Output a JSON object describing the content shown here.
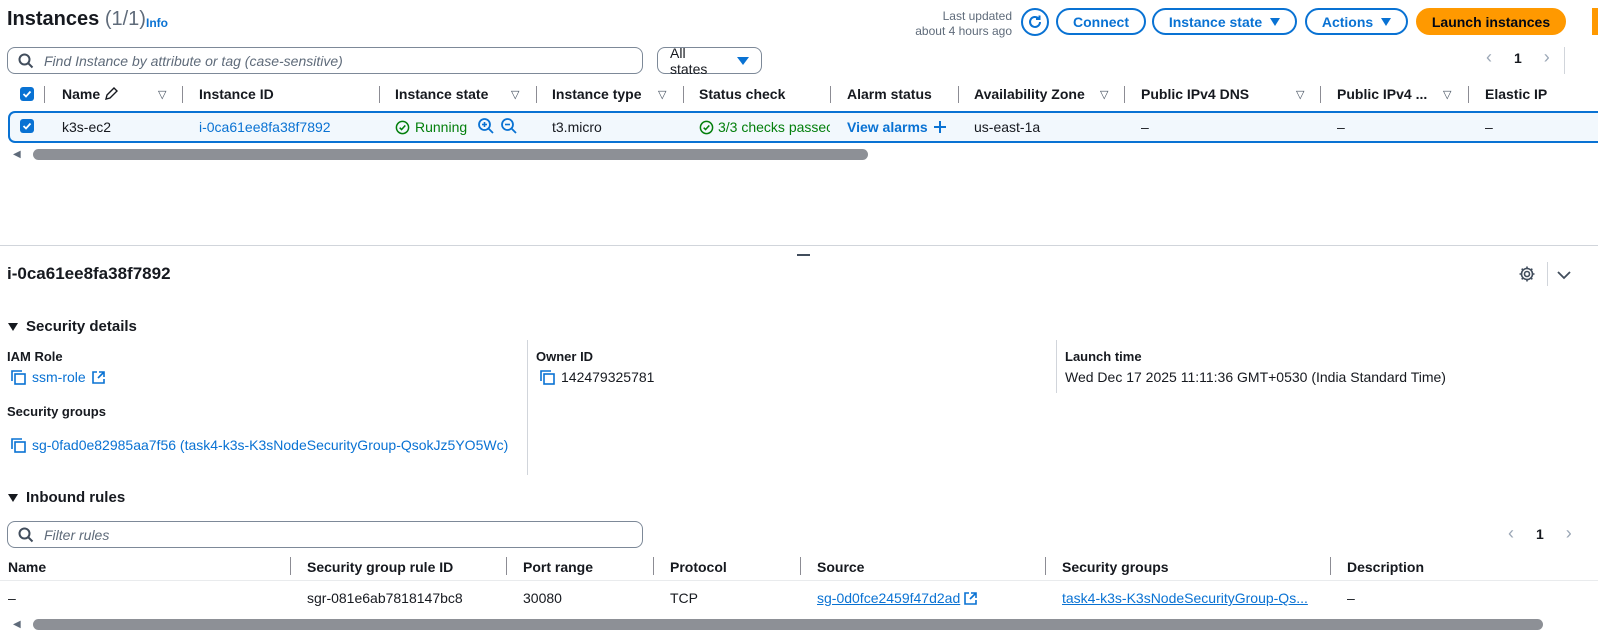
{
  "instances": {
    "title": "Instances",
    "count": "(1/1)",
    "info": "Info",
    "last_updated_label": "Last updated",
    "last_updated_value": "about 4 hours ago",
    "buttons": {
      "connect": "Connect",
      "instance_state": "Instance state",
      "actions": "Actions",
      "launch": "Launch instances"
    },
    "search_placeholder": "Find Instance by attribute or tag (case-sensitive)",
    "state_filter": "All states",
    "page": "1",
    "columns": [
      "Name",
      "Instance ID",
      "Instance state",
      "Instance type",
      "Status check",
      "Alarm status",
      "Availability Zone",
      "Public IPv4 DNS",
      "Public IPv4 ...",
      "Elastic IP"
    ],
    "row": {
      "name": "k3s-ec2",
      "instance_id": "i-0ca61ee8fa38f7892",
      "state": "Running",
      "type": "t3.micro",
      "status_check": "3/3 checks passec",
      "alarm": "View alarms",
      "az": "us-east-1a",
      "dns": "–",
      "ipv4": "–",
      "eip": "–"
    }
  },
  "details": {
    "instance_id": "i-0ca61ee8fa38f7892",
    "security_details_title": "Security details",
    "iam_role_label": "IAM Role",
    "iam_role_value": "ssm-role",
    "owner_id_label": "Owner ID",
    "owner_id_value": "142479325781",
    "launch_time_label": "Launch time",
    "launch_time_value": "Wed Dec 17 2025 11:11:36 GMT+0530 (India Standard Time)",
    "security_groups_label": "Security groups",
    "security_groups_value": "sg-0fad0e82985aa7f56 (task4-k3s-K3sNodeSecurityGroup-QsokJz5YO5Wc)",
    "inbound_title": "Inbound rules",
    "filter_placeholder": "Filter rules",
    "page": "1",
    "rule_columns": [
      "Name",
      "Security group rule ID",
      "Port range",
      "Protocol",
      "Source",
      "Security groups",
      "Description"
    ],
    "rule_row": {
      "name": "–",
      "rule_id": "sgr-081e6ab7818147bc8",
      "port": "30080",
      "protocol": "TCP",
      "source": "sg-0d0fce2459f47d2ad",
      "security_group": "task4-k3s-K3sNodeSecurityGroup-Qs...",
      "description": "–"
    }
  },
  "colors": {
    "link": "#0972d3",
    "primary": "#ff9900",
    "success": "#037f0c"
  }
}
